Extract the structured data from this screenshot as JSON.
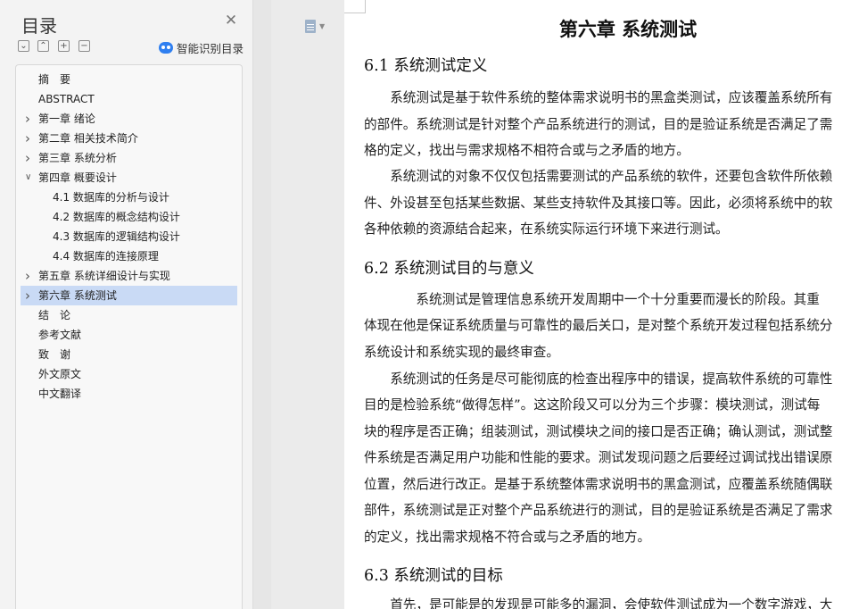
{
  "sidebar": {
    "title": "目录",
    "smart_label": "智能识别目录",
    "items": [
      {
        "label": "摘　要",
        "level": 0,
        "expandable": false,
        "expanded": false
      },
      {
        "label": "ABSTRACT",
        "level": 0,
        "expandable": false,
        "expanded": false
      },
      {
        "label": "第一章  绪论",
        "level": 0,
        "expandable": true,
        "expanded": false
      },
      {
        "label": "第二章  相关技术简介",
        "level": 0,
        "expandable": true,
        "expanded": false
      },
      {
        "label": "第三章  系统分析",
        "level": 0,
        "expandable": true,
        "expanded": false
      },
      {
        "label": "第四章  概要设计",
        "level": 0,
        "expandable": true,
        "expanded": true
      },
      {
        "label": "4.1 数据库的分析与设计",
        "level": 1,
        "expandable": false,
        "expanded": false
      },
      {
        "label": "4.2 数据库的概念结构设计",
        "level": 1,
        "expandable": false,
        "expanded": false
      },
      {
        "label": "4.3 数据库的逻辑结构设计",
        "level": 1,
        "expandable": false,
        "expanded": false
      },
      {
        "label": "4.4 数据库的连接原理",
        "level": 1,
        "expandable": false,
        "expanded": false
      },
      {
        "label": "第五章  系统详细设计与实现",
        "level": 0,
        "expandable": true,
        "expanded": false
      },
      {
        "label": "第六章  系统测试",
        "level": 0,
        "expandable": true,
        "expanded": false,
        "active": true
      },
      {
        "label": "结　论",
        "level": 0,
        "expandable": false,
        "expanded": false
      },
      {
        "label": "参考文献",
        "level": 0,
        "expandable": false,
        "expanded": false
      },
      {
        "label": "致　谢",
        "level": 0,
        "expandable": false,
        "expanded": false
      },
      {
        "label": "外文原文",
        "level": 0,
        "expandable": false,
        "expanded": false
      },
      {
        "label": "中文翻译",
        "level": 0,
        "expandable": false,
        "expanded": false
      }
    ]
  },
  "document": {
    "chapter_title": "第六章  系统测试",
    "sections": [
      {
        "heading": "6.1 系统测试定义",
        "lines": [
          "　　系统测试是基于软件系统的整体需求说明书的黑盒类测试，应该覆盖系统所有",
          "的部件。系统测试是针对整个产品系统进行的测试，目的是验证系统是否满足了需",
          "格的定义，找出与需求规格不相符合或与之矛盾的地方。",
          "　　系统测试的对象不仅仅包括需要测试的产品系统的软件，还要包含软件所依赖",
          "件、外设甚至包括某些数据、某些支持软件及其接口等。因此，必须将系统中的软",
          "各种依赖的资源结合起来，在系统实际运行环境下来进行测试。"
        ]
      },
      {
        "heading": "6.2 系统测试目的与意义",
        "lines": [
          "　　　　系统测试是管理信息系统开发周期中一个十分重要而漫长的阶段。其重",
          "体现在他是保证系统质量与可靠性的最后关口，是对整个系统开发过程包括系统分",
          "系统设计和系统实现的最终审查。",
          "　　系统测试的任务是尽可能彻底的检查出程序中的错误，提高软件系统的可靠性",
          "目的是检验系统“做得怎样”。这这阶段又可以分为三个步骤：模块测试，测试每",
          "块的程序是否正确；组装测试，测试模块之间的接口是否正确；确认测试，测试整",
          "件系统是否满足用户功能和性能的要求。测试发现问题之后要经过调试找出错误原",
          "位置，然后进行改正。是基于系统整体需求说明书的黑盒测试，应覆盖系统随偶联",
          "部件，系统测试是正对整个产品系统进行的测试，目的是验证系统是否满足了需求",
          "的定义，找出需求规格不符合或与之矛盾的地方。"
        ]
      },
      {
        "heading": "6.3 系统测试的目标",
        "lines": [
          "　　首先，是可能是的发现是可能多的漏洞，会使软件测试成为一个数字游戏，大"
        ]
      }
    ]
  },
  "colors": {
    "active_item_bg": "#c9daf5",
    "smart_icon": "#2f7ff0"
  }
}
